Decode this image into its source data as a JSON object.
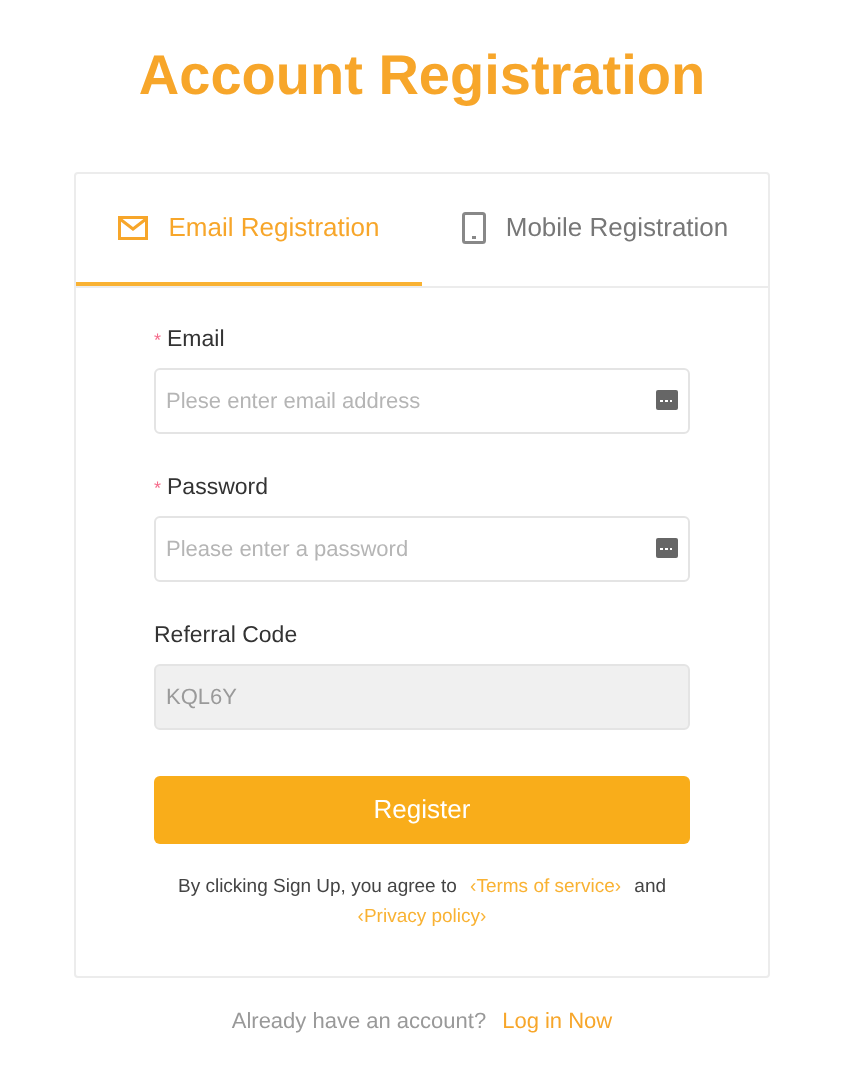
{
  "title": "Account Registration",
  "tabs": [
    {
      "label": "Email Registration",
      "kind": "mail",
      "selected": true
    },
    {
      "label": "Mobile Registration",
      "kind": "phone",
      "selected": false
    }
  ],
  "fields": [
    {
      "label": "Email",
      "mark": "*",
      "placeholder": "Plese enter email address",
      "disabled": false,
      "autofill": true
    },
    {
      "label": "Password",
      "mark": "*",
      "placeholder": "Please enter a password",
      "disabled": false,
      "autofill": true
    },
    {
      "label": "Referral Code",
      "value": "KQL6Y",
      "disabled": true,
      "autofill": false
    }
  ],
  "submit": "Register",
  "agreement": {
    "text": "By clicking Sign Up, you agree to",
    "terms": "‹Terms of service›",
    "and": "and",
    "privacy": "‹Privacy policy›"
  },
  "footer": {
    "text": "Already have an account?",
    "link": "Log in Now"
  }
}
